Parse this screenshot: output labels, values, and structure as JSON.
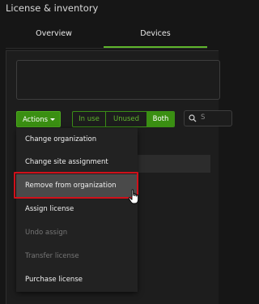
{
  "header": {
    "title": "License & inventory"
  },
  "tabs": [
    {
      "label": "Overview",
      "active": false
    },
    {
      "label": "Devices",
      "active": true
    }
  ],
  "toolbar": {
    "actions_label": "Actions",
    "filter": {
      "options": [
        "In use",
        "Unused",
        "Both"
      ],
      "selected": "Both"
    },
    "search_placeholder": "S"
  },
  "dropdown": {
    "items": [
      {
        "label": "Change organization",
        "enabled": true
      },
      {
        "label": "Change site assignment",
        "enabled": true
      },
      {
        "label": "Remove from organization",
        "enabled": true,
        "highlighted": true
      },
      {
        "label": "Assign license",
        "enabled": true
      },
      {
        "label": "Undo assign",
        "enabled": false
      },
      {
        "label": "Transfer license",
        "enabled": false
      },
      {
        "label": "Purchase license",
        "enabled": true
      }
    ]
  },
  "colors": {
    "accent": "#3a8f12",
    "accent_text": "#5fb52c",
    "highlight_border": "#d0101a",
    "background": "#161616"
  },
  "icons": {
    "search": "search-icon",
    "cursor": "hand-pointer-icon",
    "caret": "caret-down-icon"
  }
}
